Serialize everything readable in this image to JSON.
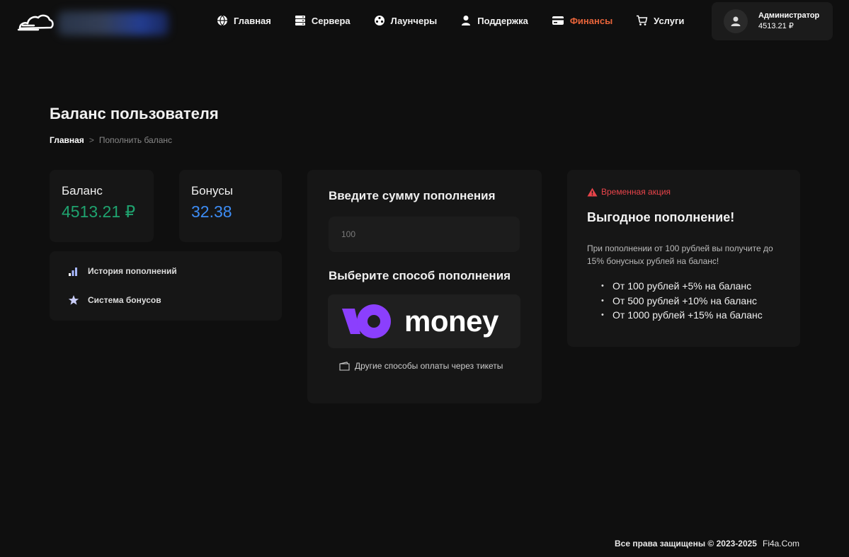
{
  "header": {
    "nav": [
      {
        "label": "Главная",
        "icon": "globe-icon"
      },
      {
        "label": "Сервера",
        "icon": "server-icon"
      },
      {
        "label": "Лаунчеры",
        "icon": "launcher-icon"
      },
      {
        "label": "Поддержка",
        "icon": "user-icon"
      },
      {
        "label": "Финансы",
        "icon": "credit-card-icon",
        "active": true
      },
      {
        "label": "Услуги",
        "icon": "cart-icon"
      }
    ],
    "user": {
      "name": "Администратор",
      "balance": "4513.21 ₽"
    }
  },
  "page": {
    "title": "Баланс пользователя",
    "breadcrumb": {
      "home": "Главная",
      "separator": ">",
      "current": "Пополнить баланс"
    }
  },
  "stats": {
    "balance": {
      "label": "Баланс",
      "value": "4513.21 ₽"
    },
    "bonuses": {
      "label": "Бонусы",
      "value": "32.38"
    }
  },
  "menu": {
    "history": "История пополнений",
    "bonus_system": "Система бонусов"
  },
  "topup": {
    "amount_heading": "Введите сумму пополнения",
    "amount_placeholder": "100",
    "method_heading": "Выберите способ пополнения",
    "method_name": "money",
    "tickets_link": "Другие способы оплаты через тикеты"
  },
  "promo": {
    "tag": "Временная акция",
    "title": "Выгодное пополнение!",
    "description": "При пополнении от 100 рублей вы получите до 15% бонусных рублей на баланс!",
    "items": [
      "От 100 рублей +5% на баланс",
      "От 500 рублей +10% на баланс",
      "От 1000 рублей +15% на баланс"
    ]
  },
  "footer": {
    "rights": "Все права защищены © 2023-2025",
    "site": "Fi4a.Com"
  },
  "colors": {
    "accent": "#e8643a",
    "balance": "#1fa36f",
    "bonus": "#3d8cf4",
    "promo_tag": "#e8444a",
    "yoomoney": "#8b3ffd"
  }
}
